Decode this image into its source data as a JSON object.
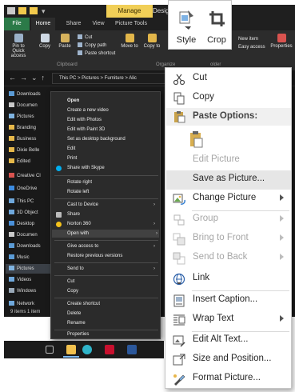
{
  "explorer": {
    "title_tabs": {
      "manage": "Manage",
      "design": "Desig"
    },
    "ribbon_tabs": [
      "File",
      "Home",
      "Share",
      "View",
      "Picture Tools"
    ],
    "ribbon": {
      "pin": "Pin to Quick access",
      "copy": "Copy",
      "paste": "Paste",
      "cut": "Cut",
      "copy_path": "Copy path",
      "paste_shortcut": "Paste shortcut",
      "move_to": "Move to",
      "copy_to": "Copy to",
      "new_item": "New item",
      "easy_access": "Easy access",
      "properties": "Properties",
      "group_clipboard": "Clipboard",
      "group_organize": "Organize",
      "group_folder": "older"
    },
    "address": "This PC  >  Pictures  >  Furniture  >  Alic",
    "nav": [
      "Downloads",
      "Documen",
      "Pictures",
      "Branding",
      "Business",
      "Dixie Belle",
      "Edited",
      "Creative Cl",
      "OneDrive",
      "This PC",
      "3D Object",
      "Desktop",
      "Documen",
      "Downloads",
      "Music",
      "Pictures",
      "Videos",
      "Windows",
      "Network"
    ],
    "status": "9 items   1 item"
  },
  "dark_menu": {
    "items": [
      "Open",
      "Create a new video",
      "Edit with Photos",
      "Edit with Paint 3D",
      "Set as desktop background",
      "Edit",
      "Print",
      "Share with Skype",
      "Rotate right",
      "Rotate left",
      "Cast to Device",
      "Share",
      "Norton 360",
      "Open with",
      "Give access to",
      "Restore previous versions",
      "Send to",
      "Cut",
      "Copy",
      "Create shortcut",
      "Delete",
      "Rename",
      "Properties"
    ]
  },
  "mini_toolbar": {
    "style": "Style",
    "crop": "Crop"
  },
  "context_menu": {
    "cut": "Cut",
    "copy": "Copy",
    "paste_options": "Paste Options:",
    "edit_picture": "Edit Picture",
    "save_as_picture": "Save as Picture...",
    "change_picture": "Change Picture",
    "group": "Group",
    "bring_to_front": "Bring to Front",
    "send_to_back": "Send to Back",
    "link": "Link",
    "insert_caption": "Insert Caption...",
    "wrap_text": "Wrap Text",
    "edit_alt_text": "Edit Alt Text...",
    "size_and_position": "Size and Position...",
    "format_picture": "Format Picture..."
  }
}
